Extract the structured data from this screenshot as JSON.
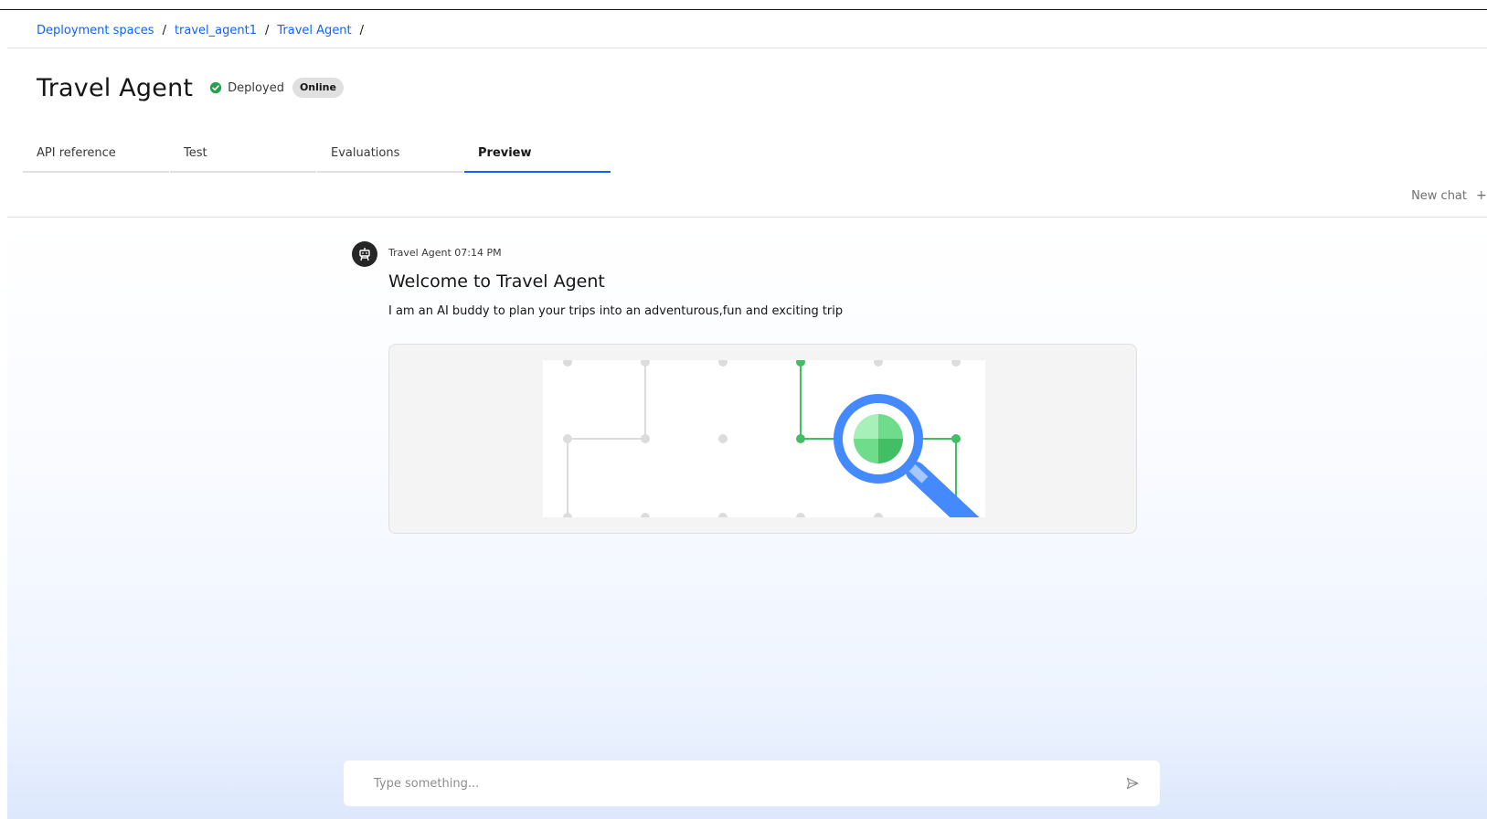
{
  "breadcrumb": {
    "items": [
      "Deployment spaces",
      "travel_agent1",
      "Travel Agent"
    ],
    "separator": "/"
  },
  "header": {
    "title": "Travel Agent",
    "status": "Deployed",
    "badge": "Online"
  },
  "tabs": [
    {
      "label": "API reference",
      "active": false
    },
    {
      "label": "Test",
      "active": false
    },
    {
      "label": "Evaluations",
      "active": false
    },
    {
      "label": "Preview",
      "active": true
    }
  ],
  "chat": {
    "new_chat_label": "New chat",
    "message": {
      "sender": "Travel Agent",
      "time": "07:14 PM",
      "title": "Welcome to Travel Agent",
      "text": "I am an AI buddy to plan your trips into an adventurous,fun and exciting trip",
      "avatar_icon": "robot-icon",
      "image_icon": "magnifier-network-illustration"
    },
    "input_placeholder": "Type something..."
  },
  "colors": {
    "accent": "#0f62fe",
    "status_green": "#24a148",
    "illustration_green": "#42be65",
    "illustration_blue": "#4589ff"
  }
}
